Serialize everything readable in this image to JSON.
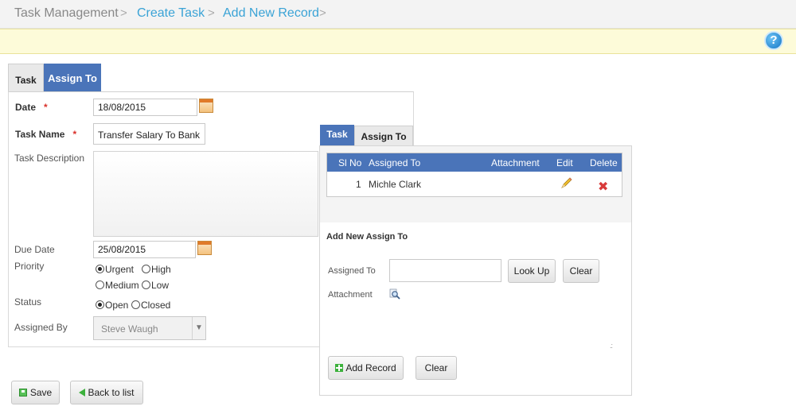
{
  "breadcrumb": {
    "items": [
      "Task Management",
      "Create Task",
      "Add New Record"
    ]
  },
  "tabs": {
    "main": [
      "Task",
      "Assign To"
    ],
    "assign": [
      "Task",
      "Assign To"
    ]
  },
  "form": {
    "date_label": "Date",
    "date_value": "18/08/2015",
    "taskname_label": "Task Name",
    "taskname_value": "Transfer Salary To Bank",
    "description_label": "Task Description",
    "duedate_label": "Due Date",
    "duedate_value": "25/08/2015",
    "priority_label": "Priority",
    "priority_options": [
      "Urgent",
      "High",
      "Medium",
      "Low"
    ],
    "priority_selected": "Urgent",
    "status_label": "Status",
    "status_options": [
      "Open",
      "Closed"
    ],
    "status_selected": "Open",
    "assignedby_label": "Assigned By",
    "assignedby_value": "Steve Waugh",
    "required_mark": "*"
  },
  "assign_grid": {
    "columns": [
      "Sl No",
      "Assigned To",
      "Attachment",
      "Edit",
      "Delete"
    ],
    "rows": [
      {
        "slno": "1",
        "assigned_to": "Michle Clark",
        "attachment": ""
      }
    ]
  },
  "assign_form": {
    "title": "Add New Assign To",
    "assignedto_label": "Assigned To",
    "assignedto_value": "",
    "attachment_label": "Attachment",
    "lookup_label": "Look Up",
    "clear_label": "Clear",
    "addrecord_label": "Add Record",
    "clear2_label": "Clear"
  },
  "footer": {
    "save_label": "Save",
    "back_label": "Back to list"
  },
  "colors": {
    "accent": "#4a74b9",
    "link": "#3aa3d6",
    "required": "#d9302a",
    "infobar": "#fdfbd9"
  },
  "icons": {
    "help": "?",
    "calendar": "calendar-icon",
    "pencil": "edit-icon",
    "delete": "✖",
    "magnifier": "magnifier-icon"
  }
}
